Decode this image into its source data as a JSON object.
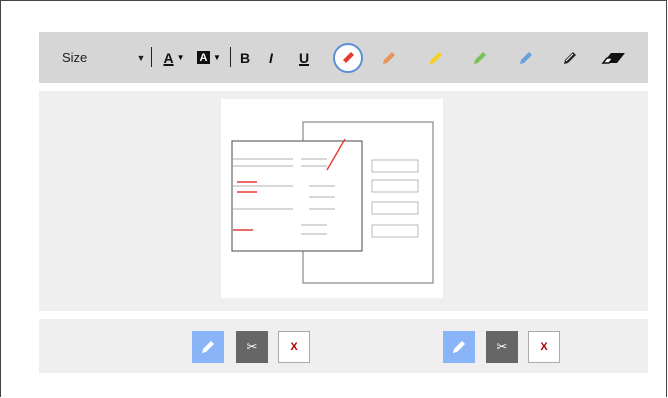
{
  "toolbar": {
    "size_label": "Size",
    "font_color_letter": "A",
    "highlight_letter": "A",
    "bold_label": "B",
    "italic_label": "I",
    "underline_label": "U",
    "pens": [
      {
        "name": "red-pen",
        "color": "#e53935",
        "active": true
      },
      {
        "name": "orange-pen",
        "color": "#e8935a"
      },
      {
        "name": "yellow-pen",
        "color": "#f2d027"
      },
      {
        "name": "green-pen",
        "color": "#7cc05a"
      },
      {
        "name": "blue-pen",
        "color": "#6aa0dc"
      },
      {
        "name": "black-pen",
        "color": "#222222"
      }
    ],
    "eraser_icon": "eraser-icon"
  },
  "bottom_bar": {
    "groups": [
      {
        "edit_icon": "pencil-icon",
        "cut_label": "✂",
        "close_label": "X"
      },
      {
        "edit_icon": "pencil-icon",
        "cut_label": "✂",
        "close_label": "X"
      }
    ]
  },
  "colors": {
    "toolbar_bg": "#d6d6d6",
    "panel_bg": "#efefef",
    "accent": "#8ab4f8",
    "annotation": "#e53935"
  }
}
